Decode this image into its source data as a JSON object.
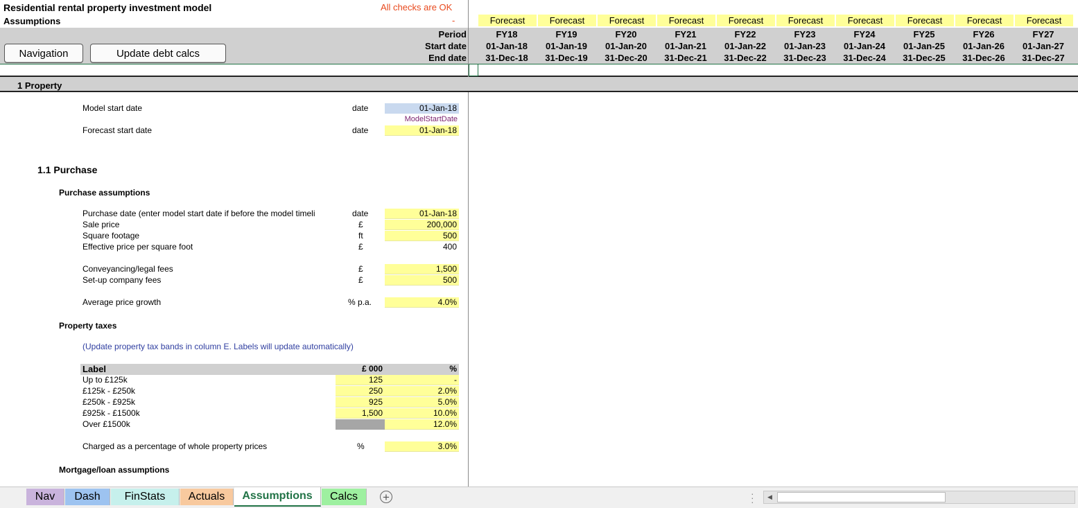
{
  "header": {
    "title": "Residential rental property investment model",
    "subtitle": "Assumptions",
    "checks": "All checks are OK",
    "checks_dash": "-",
    "period_label": "Period",
    "start_label": "Start date",
    "end_label": "End date",
    "nav_button": "Navigation",
    "update_button": "Update debt calcs"
  },
  "timeline": [
    {
      "flag": "Forecast",
      "fy": "FY18",
      "start": "01-Jan-18",
      "end": "31-Dec-18"
    },
    {
      "flag": "Forecast",
      "fy": "FY19",
      "start": "01-Jan-19",
      "end": "31-Dec-19"
    },
    {
      "flag": "Forecast",
      "fy": "FY20",
      "start": "01-Jan-20",
      "end": "31-Dec-20"
    },
    {
      "flag": "Forecast",
      "fy": "FY21",
      "start": "01-Jan-21",
      "end": "31-Dec-21"
    },
    {
      "flag": "Forecast",
      "fy": "FY22",
      "start": "01-Jan-22",
      "end": "31-Dec-22"
    },
    {
      "flag": "Forecast",
      "fy": "FY23",
      "start": "01-Jan-23",
      "end": "31-Dec-23"
    },
    {
      "flag": "Forecast",
      "fy": "FY24",
      "start": "01-Jan-24",
      "end": "31-Dec-24"
    },
    {
      "flag": "Forecast",
      "fy": "FY25",
      "start": "01-Jan-25",
      "end": "31-Dec-25"
    },
    {
      "flag": "Forecast",
      "fy": "FY26",
      "start": "01-Jan-26",
      "end": "31-Dec-26"
    },
    {
      "flag": "Forecast",
      "fy": "FY27",
      "start": "01-Jan-27",
      "end": "31-Dec-27"
    }
  ],
  "section1": {
    "title": "1 Property",
    "model_start_label": "Model start date",
    "model_start_unit": "date",
    "model_start_value": "01-Jan-18",
    "model_start_name": "ModelStartDate",
    "forecast_start_label": "Forecast start date",
    "forecast_start_unit": "date",
    "forecast_start_value": "01-Jan-18"
  },
  "purchase": {
    "title": "1.1  Purchase",
    "assumptions_title": "Purchase assumptions",
    "rows": [
      {
        "label": "Purchase date (enter model start date if before the model timeli",
        "unit": "date",
        "value": "01-Jan-18",
        "input": true
      },
      {
        "label": "Sale price",
        "unit": "£",
        "value": "200,000",
        "input": true
      },
      {
        "label": "Square footage",
        "unit": "ft",
        "value": "500",
        "input": true
      },
      {
        "label": "Effective price per square foot",
        "unit": "£",
        "value": "400",
        "input": false
      }
    ],
    "fees": [
      {
        "label": "Conveyancing/legal fees",
        "unit": "£",
        "value": "1,500"
      },
      {
        "label": "Set-up company fees",
        "unit": "£",
        "value": "500"
      }
    ],
    "growth_label": "Average price growth",
    "growth_unit": "% p.a.",
    "growth_value": "4.0%"
  },
  "taxes": {
    "title": "Property taxes",
    "note": "(Update property tax bands in column E. Labels will update automatically)",
    "head_label": "Label",
    "head_band": "£ 000",
    "head_pct": "%",
    "bands": [
      {
        "label": "Up to £125k",
        "band": "125",
        "pct": "-"
      },
      {
        "label": "£125k - £250k",
        "band": "250",
        "pct": "2.0%"
      },
      {
        "label": "£250k - £925k",
        "band": "925",
        "pct": "5.0%"
      },
      {
        "label": "£925k - £1500k",
        "band": "1,500",
        "pct": "10.0%"
      },
      {
        "label": "Over £1500k",
        "band": "",
        "pct": "12.0%"
      }
    ],
    "charged_label": "Charged as a percentage of whole property prices",
    "charged_unit": "%",
    "charged_value": "3.0%"
  },
  "mortgage": {
    "title": "Mortgage/loan assumptions"
  },
  "tabs": [
    {
      "label": "Nav",
      "color": "#c9b3dc"
    },
    {
      "label": "Dash",
      "color": "#9dc3f0"
    },
    {
      "label": "FinStats",
      "color": "#c6f0ec"
    },
    {
      "label": "Actuals",
      "color": "#f8c99e"
    },
    {
      "label": "Assumptions",
      "color": "#ffffff"
    },
    {
      "label": "Calcs",
      "color": "#9ef0a0"
    }
  ],
  "add_sheet_icon": "plus-circle-icon",
  "colors": {
    "input": "#ffff99",
    "check": "#e8491d",
    "header_grey": "#d0d0d0",
    "active_tab": "#217346"
  }
}
